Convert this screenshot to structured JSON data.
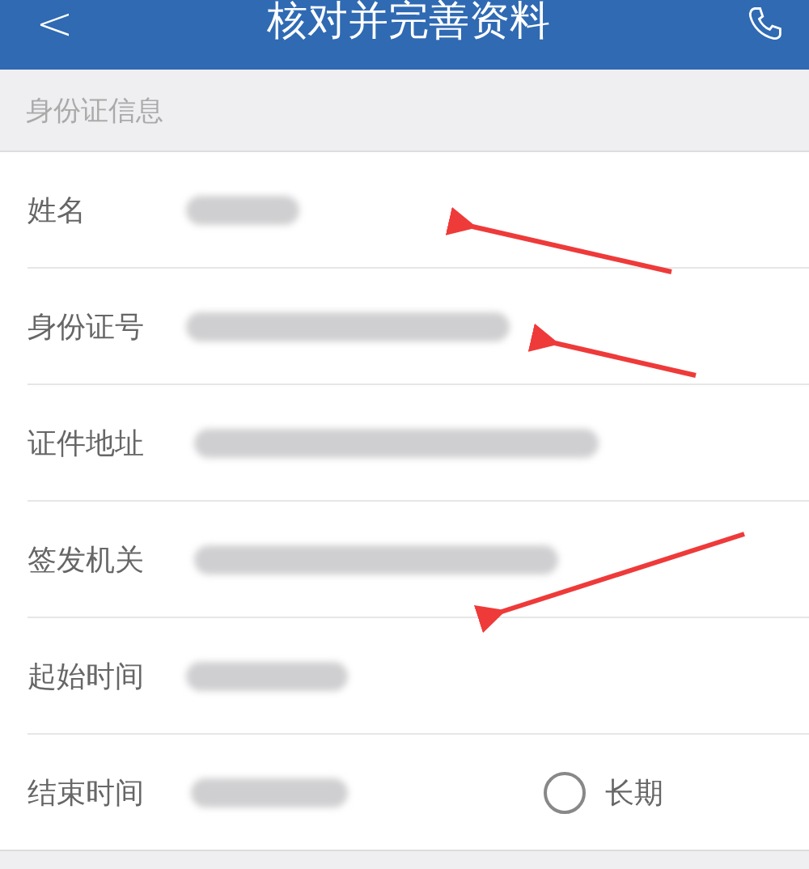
{
  "header": {
    "back": "<",
    "title": "核对并完善资料"
  },
  "section": {
    "title": "身份证信息"
  },
  "fields": [
    {
      "label": "姓名"
    },
    {
      "label": "身份证号"
    },
    {
      "label": "证件地址"
    },
    {
      "label": "签发机关"
    },
    {
      "label": "起始时间"
    },
    {
      "label": "结束时间",
      "option": {
        "label": "长期",
        "checked": false
      }
    }
  ]
}
